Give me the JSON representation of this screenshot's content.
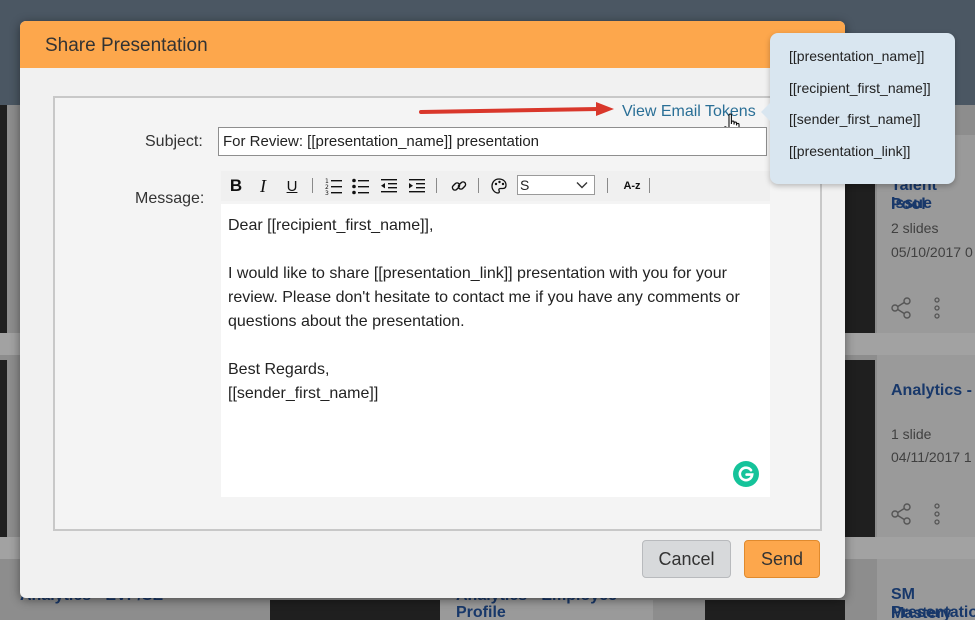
{
  "modal": {
    "title": "Share Presentation",
    "view_tokens_label": "View Email Tokens",
    "subject_label": "Subject:",
    "subject_value": "For Review: [[presentation_name]] presentation",
    "message_label": "Message:",
    "message_lines": [
      "Dear [[recipient_first_name]],",
      "",
      "I would like to share [[presentation_link]] presentation with you for your review. Please don't hesitate to contact me if you have any comments or questions about the presentation.",
      "",
      "Best Regards,",
      "[[sender_first_name]]"
    ],
    "font_select_value": "S",
    "cancel_label": "Cancel",
    "send_label": "Send"
  },
  "toolbar": {
    "bold": "B",
    "italic": "I",
    "underline": "U",
    "case_label": "A-z"
  },
  "tokens": [
    "[[presentation_name]]",
    "[[recipient_first_name]]",
    "[[sender_first_name]]",
    "[[presentation_link]]"
  ],
  "background_cards": [
    {
      "title_line1": "Talent Pool",
      "title_line2": "Issue",
      "slides": "2 slides",
      "date": "05/10/2017 0"
    },
    {
      "title_line1": "Analytics -",
      "slides": "1 slide",
      "date": "04/11/2017 1"
    },
    {
      "title_line1": "SM Mastery",
      "title_line2": "Presentation"
    }
  ],
  "background_bottom": {
    "left_title": "Analytics - EVP/SE",
    "center_title_line1": "Analytics - Employee",
    "center_title_line2": "Profile"
  },
  "colors": {
    "header_orange": "#fda74c",
    "link_blue": "#2a6f96",
    "card_title_blue": "#18386a",
    "arrow_red": "#d9372b",
    "grammarly_green": "#15c39a"
  }
}
